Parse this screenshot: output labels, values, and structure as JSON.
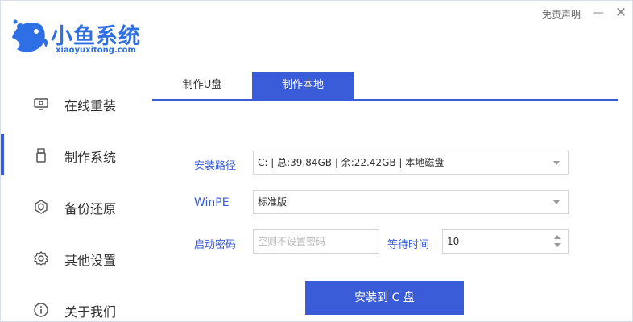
{
  "app": {
    "brand": "小鱼系统",
    "domain": "xiaoyuxitong.com",
    "disclaimer": "免责声明",
    "minimize_glyph": "—",
    "close_glyph": "✕"
  },
  "sidebar": {
    "items": [
      {
        "label": "在线重装",
        "icon": "monitor-icon"
      },
      {
        "label": "制作系统",
        "icon": "usb-drive-icon",
        "active": true
      },
      {
        "label": "备份还原",
        "icon": "backup-restore-icon"
      },
      {
        "label": "其他设置",
        "icon": "gear-icon"
      },
      {
        "label": "关于我们",
        "icon": "info-icon"
      }
    ]
  },
  "tabs": [
    {
      "label": "制作U盘",
      "active": false
    },
    {
      "label": "制作本地",
      "active": true
    }
  ],
  "form": {
    "install_path_label": "安装路径",
    "install_path_value": "C: | 总:39.84GB | 余:22.42GB | 本地磁盘",
    "winpe_label": "WinPE",
    "winpe_value": "标准版",
    "boot_password_label": "启动密码",
    "boot_password_placeholder": "空则不设置密码",
    "wait_time_label": "等待时间",
    "wait_time_value": "10"
  },
  "actions": {
    "install_label": "安装到 C 盘"
  },
  "colors": {
    "accent": "#3b5cd9",
    "brand": "#2e6fe6"
  }
}
